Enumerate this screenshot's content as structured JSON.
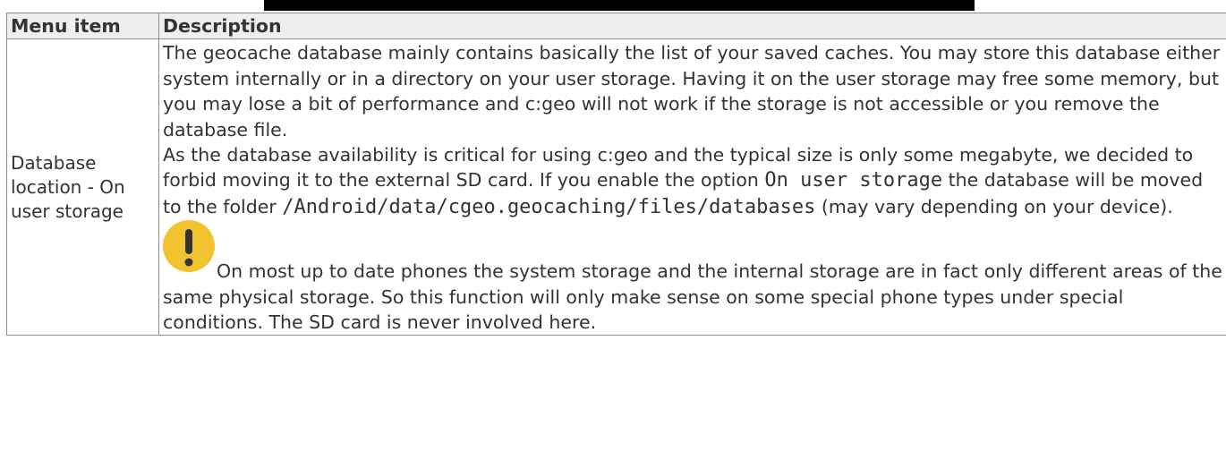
{
  "table": {
    "headers": [
      "Menu item",
      "Description"
    ],
    "row": {
      "menu_item": "Database location - On user storage",
      "paragraph1": "The geocache database mainly contains basically the list of your saved caches. You may store this database either system internally or in a directory on your user storage. Having it on the user storage may free some memory, but you may lose a bit of performance and c:geo will not work if the storage is not accessible or you remove the database file.",
      "paragraph2_part1": "As the database availability is critical for using c:geo and the typical size is only some megabyte, we decided to forbid moving it to the external SD card. If you enable the option ",
      "paragraph2_code1": "On user storage",
      "paragraph2_part2": " the database will be moved to the folder ",
      "paragraph2_code2": "/Android/data/cgeo.geocaching/files/databases",
      "paragraph2_part3": " (may vary depending on your device).",
      "note_text": "On most up to date phones the system storage and the internal storage are in fact only different areas of the same physical storage. So this function will only make sense on some special phone types under special conditions. The SD card is never involved here."
    }
  },
  "icons": {
    "note_icon": "exclamation-warning-icon",
    "note_icon_color": "#f2c230"
  },
  "colors": {
    "header_bg": "#eeeeee",
    "border": "#8c8c8c",
    "text": "#333333",
    "top_bar": "#000000"
  }
}
